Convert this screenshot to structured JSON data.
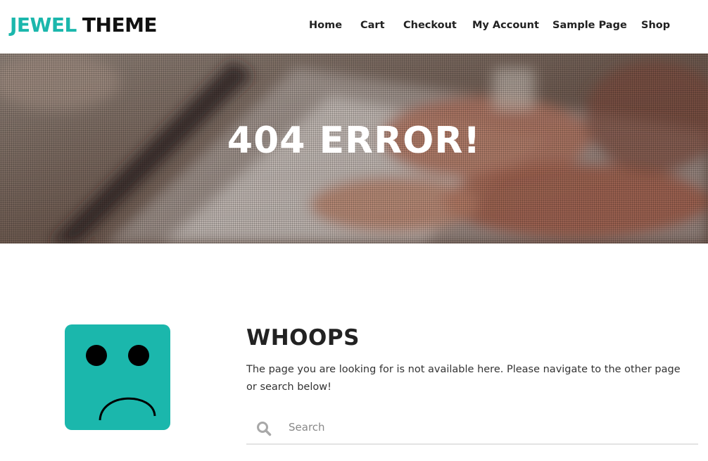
{
  "header": {
    "logo_part1": "JEWEL",
    "logo_part2": "THEME",
    "nav": [
      {
        "label": "Home"
      },
      {
        "label": "Cart"
      },
      {
        "label": "Checkout"
      },
      {
        "label": "My Account"
      },
      {
        "label": "Sample Page"
      },
      {
        "label": "Shop"
      }
    ]
  },
  "hero": {
    "title": "404 ERROR!"
  },
  "content": {
    "heading": "WHOOPS",
    "message": "The page you are looking for is not available here. Please navigate to the other page or search below!",
    "search_placeholder": "Search"
  },
  "colors": {
    "accent": "#1bb7ac",
    "text_dark": "#222222"
  },
  "icons": {
    "search": "search-icon",
    "sad_face": "sad-face-icon"
  }
}
